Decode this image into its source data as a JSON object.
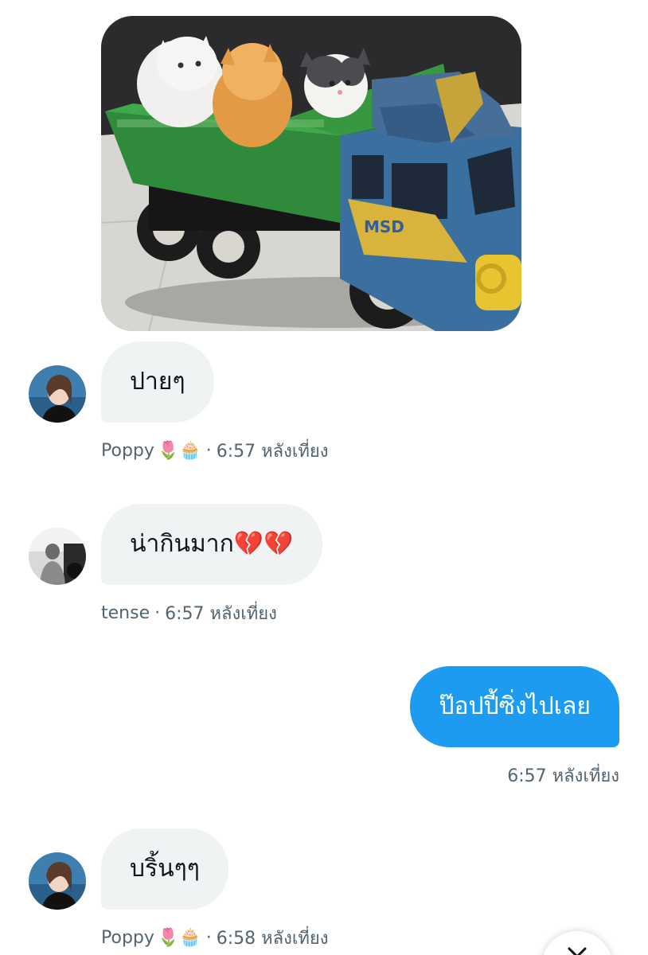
{
  "messages": [
    {
      "id": "m1",
      "type": "image",
      "image_alt": "Three kittens riding in the dump bed of a toy truck",
      "truck_badge_text": "MSD"
    },
    {
      "id": "m2",
      "type": "received",
      "text": "ปายๆ",
      "sender": "Poppy",
      "sender_emoji": "🌷🧁",
      "separator": "·",
      "time": "6:57 หลังเที่ยง"
    },
    {
      "id": "m3",
      "type": "received",
      "text": "น่ากินมาก💔💔",
      "sender": "tense",
      "separator": "·",
      "time": "6:57 หลังเที่ยง"
    },
    {
      "id": "m4",
      "type": "sent",
      "text": "ป๊อปปี้ซิ่งไปเลย",
      "time": "6:57 หลังเที่ยง"
    },
    {
      "id": "m5",
      "type": "received",
      "text": "บริ้นๆๆ",
      "sender": "Poppy",
      "sender_emoji": "🌷🧁",
      "separator": "·",
      "time": "6:58 หลังเที่ยง"
    }
  ],
  "icons": {
    "scroll_down": "chevron-down-icon"
  },
  "colors": {
    "sent_bubble": "#1d9bf0",
    "received_bubble": "#eff3f4",
    "meta_text": "#536471"
  }
}
